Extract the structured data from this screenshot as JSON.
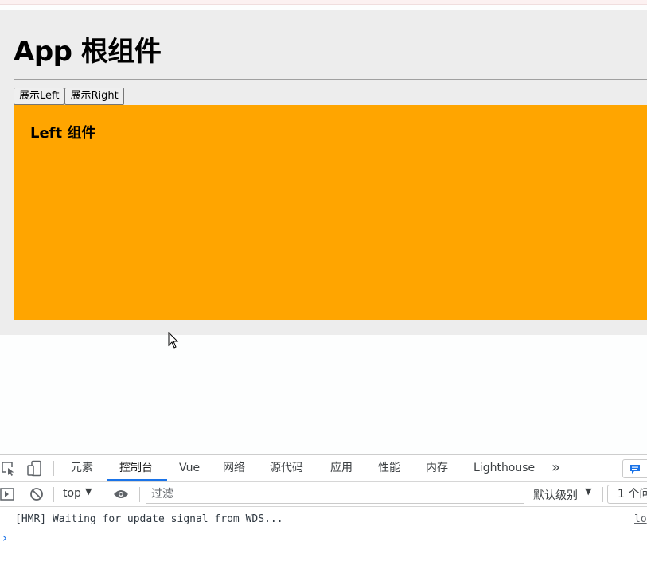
{
  "app": {
    "title": "App 根组件",
    "buttons": {
      "show_left": "展示Left",
      "show_right": "展示Right"
    },
    "left_panel": {
      "title": "Left 组件",
      "bg_color": "#ffa500"
    }
  },
  "devtools": {
    "tabs": [
      {
        "label": "元素"
      },
      {
        "label": "控制台",
        "active": true
      },
      {
        "label": "Vue"
      },
      {
        "label": "网络"
      },
      {
        "label": "源代码"
      },
      {
        "label": "应用"
      },
      {
        "label": "性能"
      },
      {
        "label": "内存"
      },
      {
        "label": "Lighthouse"
      }
    ],
    "more_tabs_glyph": "»",
    "toolbar": {
      "context": "top",
      "filter_placeholder": "过滤",
      "level": "默认级别",
      "issues": "1 个问"
    },
    "console": {
      "line": "[HMR] Waiting for update signal from WDS...",
      "source_link": "lo",
      "prompt": "›"
    },
    "accent_color": "#1a73e8"
  }
}
